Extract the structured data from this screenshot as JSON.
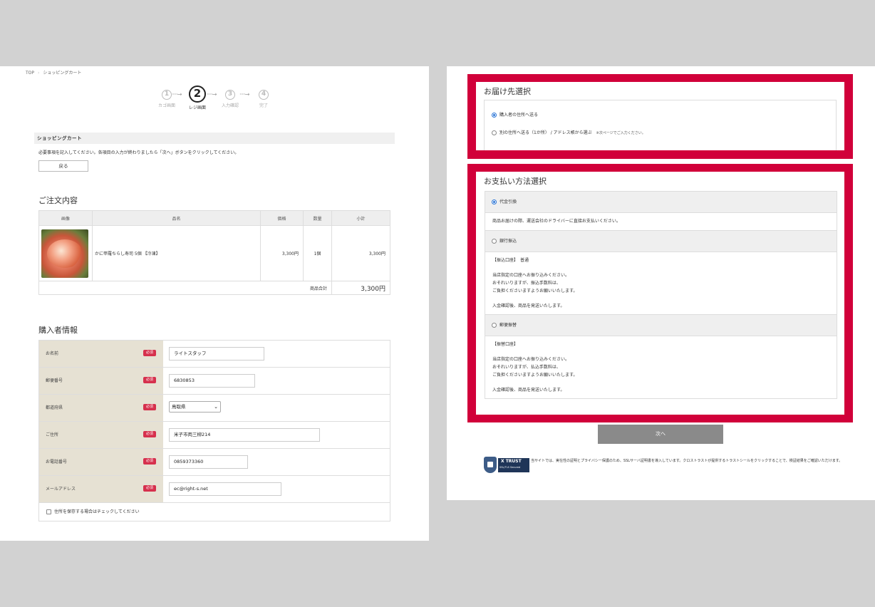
{
  "breadcrumb": {
    "home": "TOP",
    "separator": "›",
    "current": "ショッピングカート"
  },
  "steps": [
    {
      "num": "1",
      "label": "カゴ画面",
      "active": false
    },
    {
      "num": "2",
      "label": "レジ画面",
      "active": true
    },
    {
      "num": "3",
      "label": "入力確認",
      "active": false
    },
    {
      "num": "4",
      "label": "完了",
      "active": false
    }
  ],
  "step_arrow": "·····→",
  "cart": {
    "heading": "ショッピングカート",
    "notice": "必要事項を記入してください。各項目の入力が終わりましたら「次へ」ボタンをクリックしてください。",
    "back_label": "戻る"
  },
  "order": {
    "heading": "ご注文内容",
    "columns": [
      "画像",
      "品名",
      "価格",
      "数量",
      "小計"
    ],
    "items": [
      {
        "image": "sushi-image",
        "name": "かに甲羅ちらし寿司 5個 【冷凍】",
        "price": "3,300円",
        "qty": "1個",
        "subtotal": "3,300円"
      }
    ],
    "total_label": "商品合計",
    "total_value": "3,300円"
  },
  "buyer": {
    "heading": "購入者情報",
    "required_label": "必須",
    "fields": [
      {
        "label": "お名前",
        "value": "ライトスタッフ"
      },
      {
        "label": "郵便番号",
        "value": "6830853"
      },
      {
        "label": "都道府県",
        "value": "鳥取県"
      },
      {
        "label": "ご住所",
        "value": "米子市両三柳214"
      },
      {
        "label": "お電話番号",
        "value": "0859373360"
      },
      {
        "label": "メールアドレス",
        "value": "ec@right-s.net"
      }
    ],
    "save_label": "住所を保存する場合はチェックしてください"
  },
  "delivery": {
    "heading": "お届け先選択",
    "option1": "購入者の住所へ送る",
    "option2": "別の住所へ送る（1か所） / アドレス帳から選ぶ",
    "option2_note": "※次ページでご入力ください。"
  },
  "payment": {
    "heading": "お支払い方法選択",
    "methods": [
      {
        "label": "代金引換",
        "selected": true,
        "lines": [
          "商品お届けの際、運送会社のドライバーに直接お支払いください。"
        ]
      },
      {
        "label": "銀行振込",
        "selected": false,
        "lines": [
          "【振込口座】　普通",
          "",
          "当店指定の口座へお振り込みください。",
          "おそれいりますが、振込手数料は、",
          "ご負担くださいますようお願いいたします。",
          "",
          "入金確認後、商品を発送いたします。"
        ]
      },
      {
        "label": "郵便振替",
        "selected": false,
        "lines": [
          "【振替口座】",
          "",
          "当店指定の口座へお振り込みください。",
          "おそれいりますが、払込手数料は、",
          "ご負担くださいますようお願いいたします。",
          "",
          "入金確認後、商品を発送いたします。"
        ]
      }
    ]
  },
  "next_label": "次へ",
  "trust": {
    "logo_name": "X TRUST",
    "logo_sub": "SSL/TLS Secured",
    "text": "当サイトでは、実在性の証明とプライバシー保護のため、SSLサーバ証明書を導入しています。クロストラストが提供するトラストシールをクリックすることで、検証結果をご確認いただけます。"
  },
  "colors": {
    "accent_red": "#d1003a",
    "required_badge": "#d6304d",
    "label_bg": "#e6e1d3",
    "radio_on": "#2a74d6",
    "next_button": "#8a8a8a"
  }
}
